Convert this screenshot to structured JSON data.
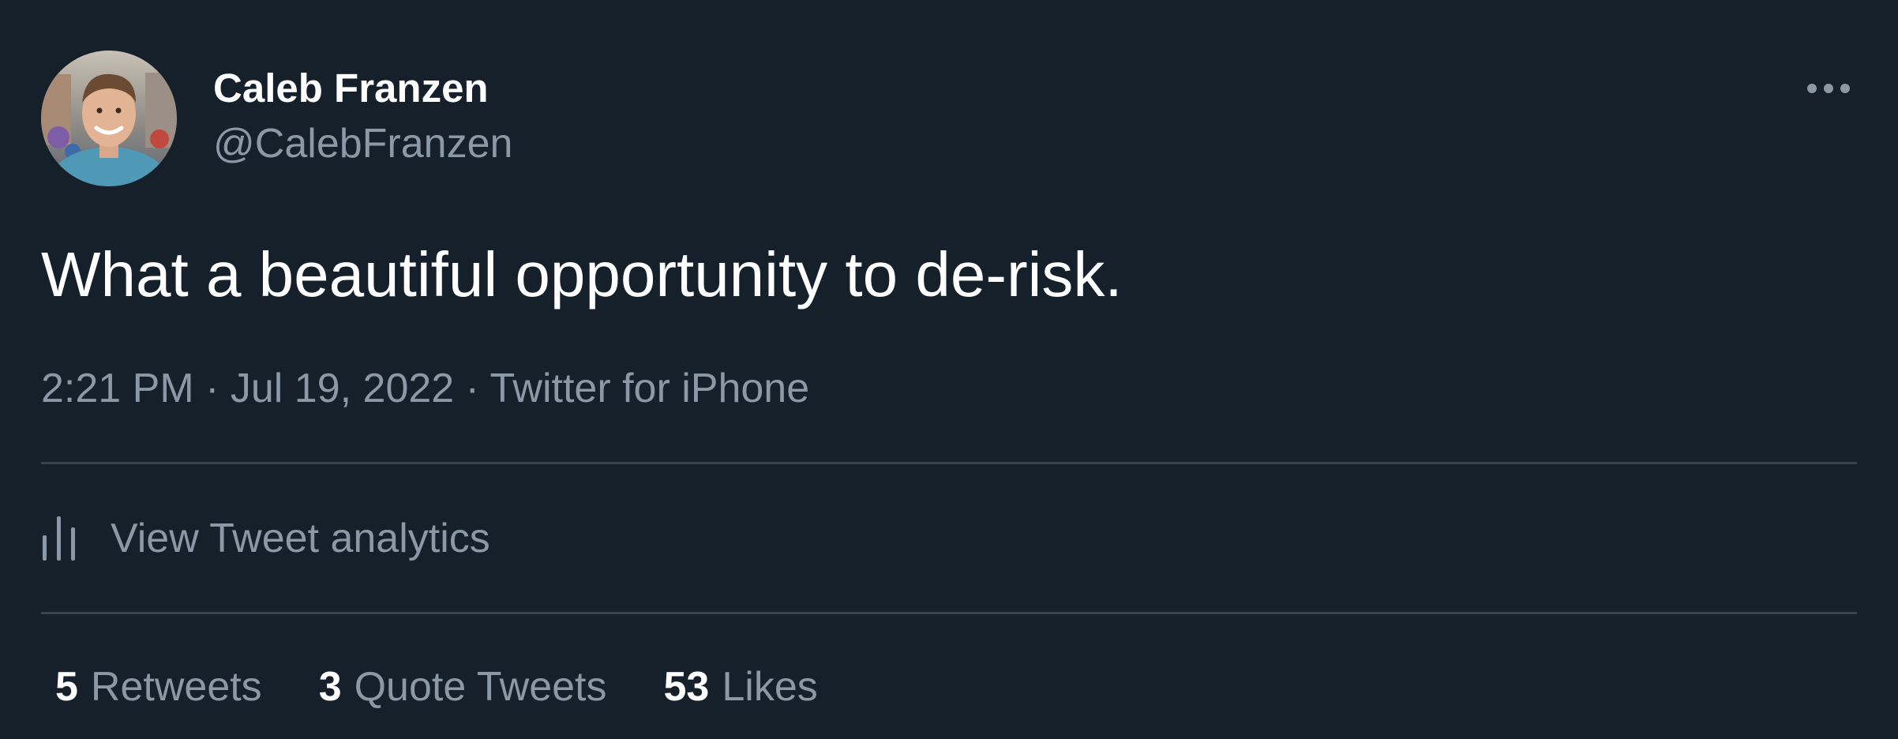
{
  "author": {
    "display_name": "Caleb Franzen",
    "handle": "@CalebFranzen"
  },
  "more_icon": "more-horizontal-icon",
  "tweet": {
    "text": "What a beautiful opportunity to de-risk."
  },
  "meta": {
    "time": "2:21 PM",
    "separator": "·",
    "date": "Jul 19, 2022",
    "source": "Twitter for iPhone"
  },
  "analytics": {
    "icon": "analytics-icon",
    "label": "View Tweet analytics"
  },
  "stats": [
    {
      "count": "5",
      "label": "Retweets"
    },
    {
      "count": "3",
      "label": "Quote Tweets"
    },
    {
      "count": "53",
      "label": "Likes"
    }
  ],
  "colors": {
    "background": "#15202b",
    "primary_text": "#ffffff",
    "secondary_text": "#8b98a5",
    "divider": "#38444d"
  }
}
